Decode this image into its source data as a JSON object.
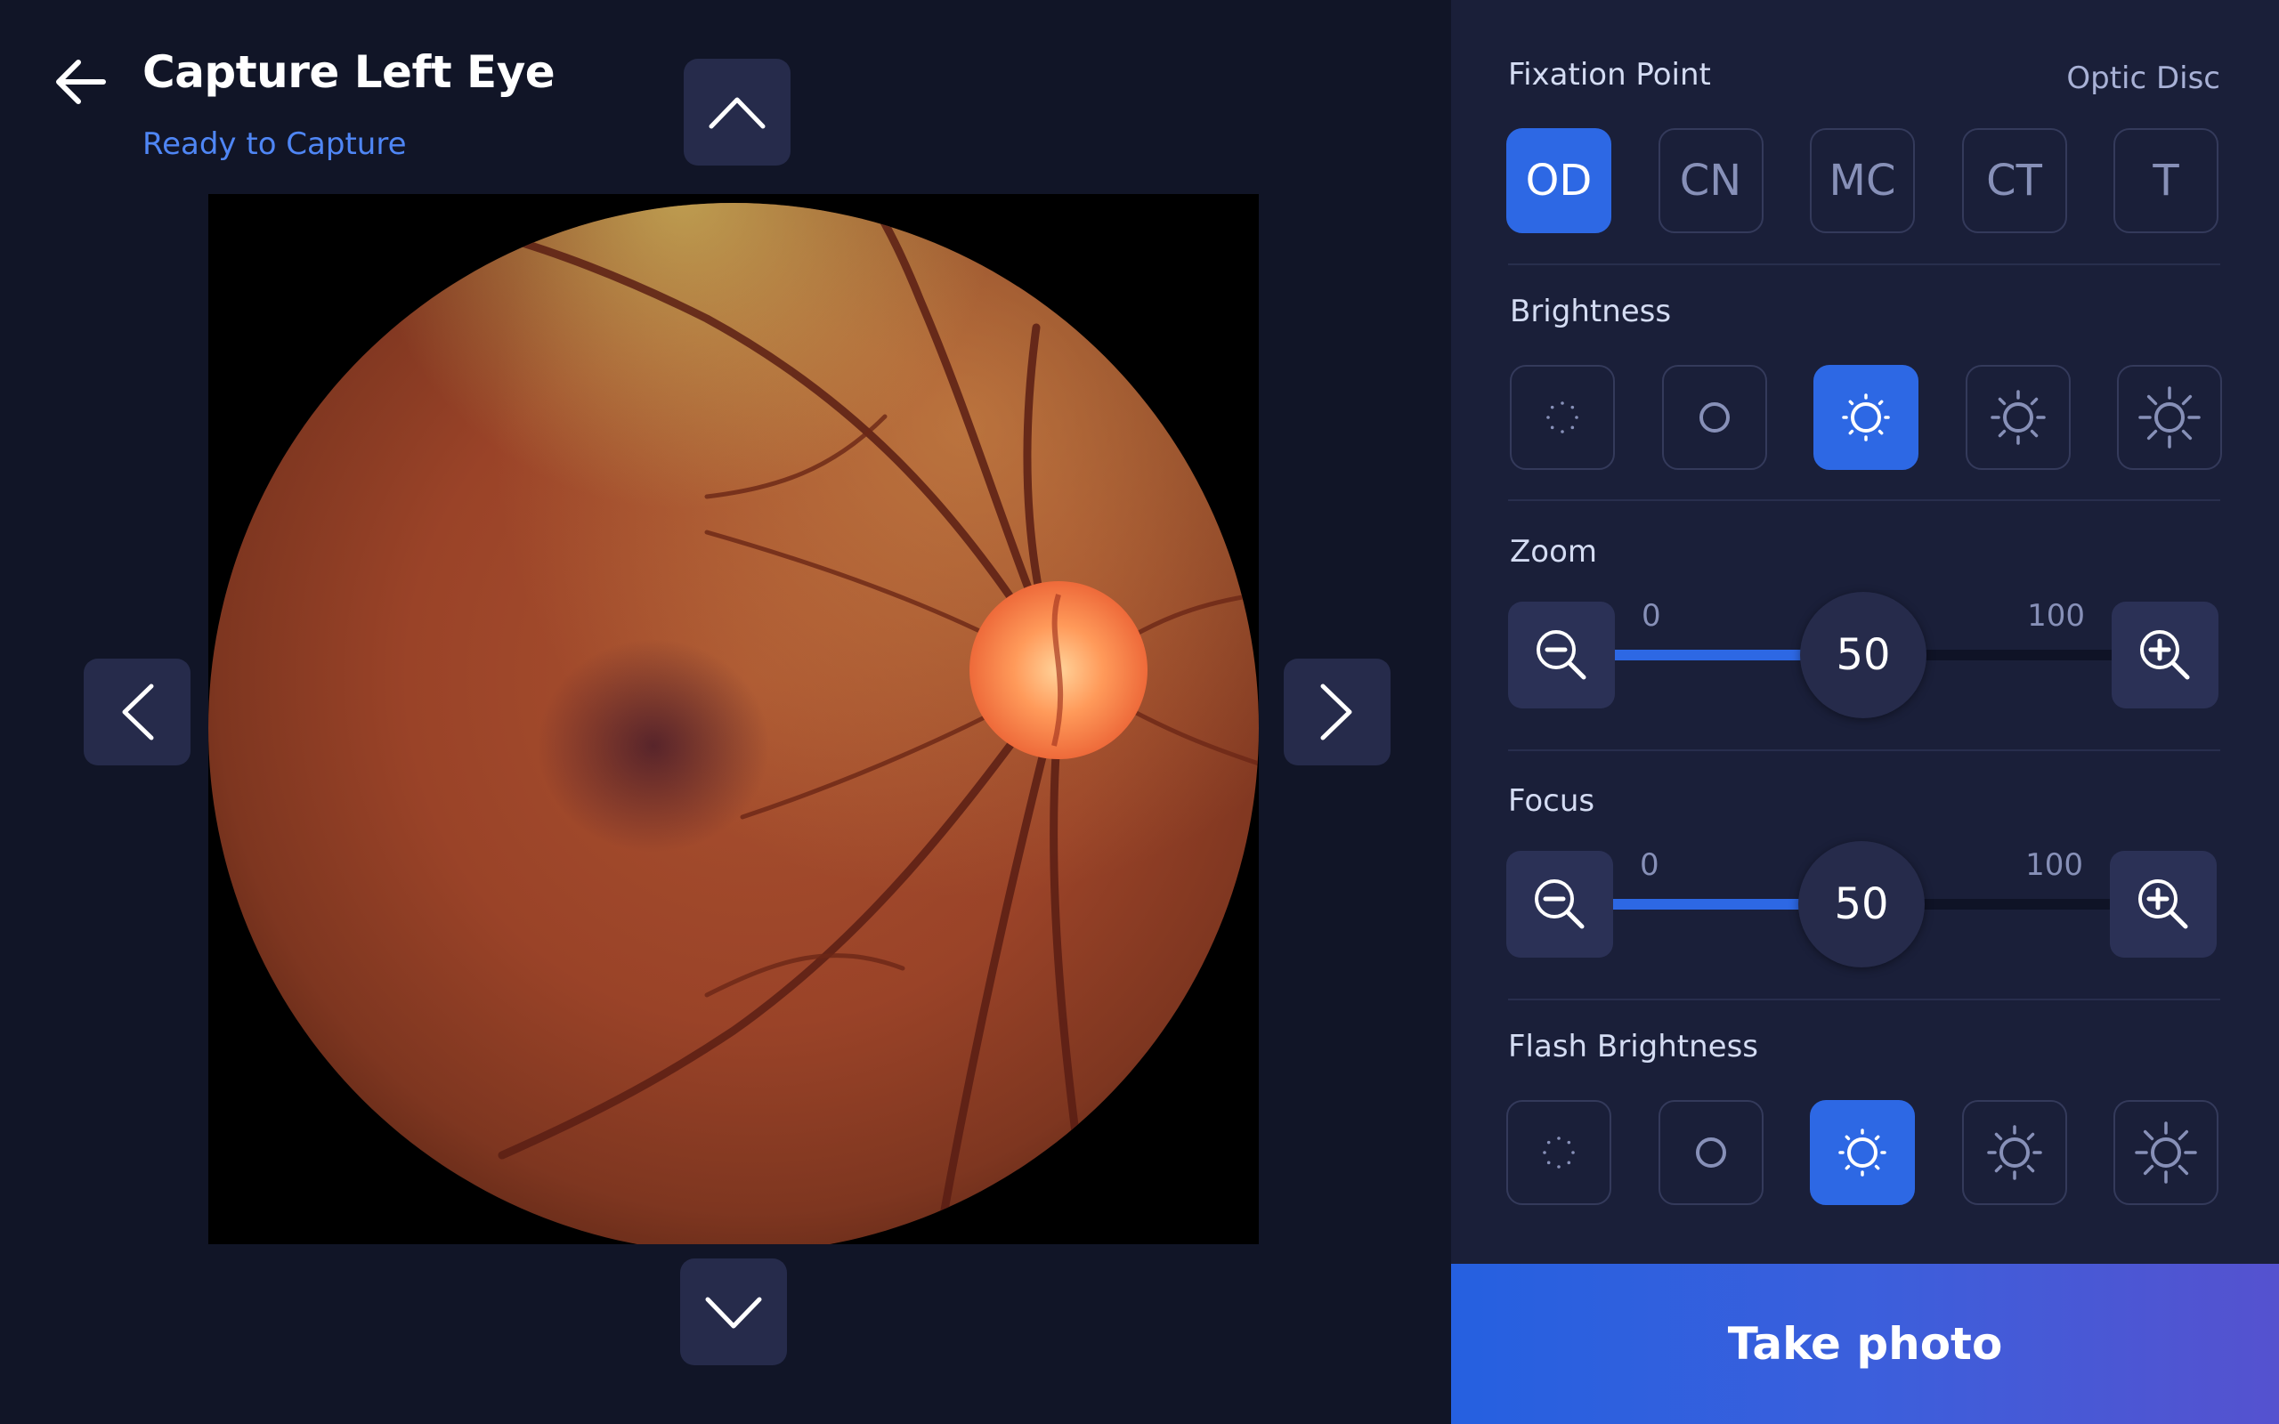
{
  "header": {
    "title": "Capture Left Eye",
    "status": "Ready to Capture"
  },
  "fixation": {
    "label": "Fixation Point",
    "selected_name": "Optic Disc",
    "options": [
      "OD",
      "CN",
      "MC",
      "CT",
      "T"
    ],
    "selected_index": 0
  },
  "brightness": {
    "label": "Brightness",
    "levels": 5,
    "selected_level": 3
  },
  "zoom": {
    "label": "Zoom",
    "min": "0",
    "max": "100",
    "value": "50"
  },
  "focus": {
    "label": "Focus",
    "min": "0",
    "max": "100",
    "value": "50"
  },
  "flash": {
    "label": "Flash Brightness",
    "levels": 5,
    "selected_level": 3
  },
  "actions": {
    "take_photo": "Take photo"
  },
  "icons": {
    "back": "arrow-left-icon",
    "up": "chevron-up-icon",
    "down": "chevron-down-icon",
    "left": "chevron-left-icon",
    "right": "chevron-right-icon",
    "zoom_out": "zoom-out-icon",
    "zoom_in": "zoom-in-icon",
    "brightness": "sun-icon"
  },
  "colors": {
    "background": "#111527",
    "panel": "#1a1f39",
    "accent": "#2d68e4",
    "status_text": "#4f86f5"
  }
}
